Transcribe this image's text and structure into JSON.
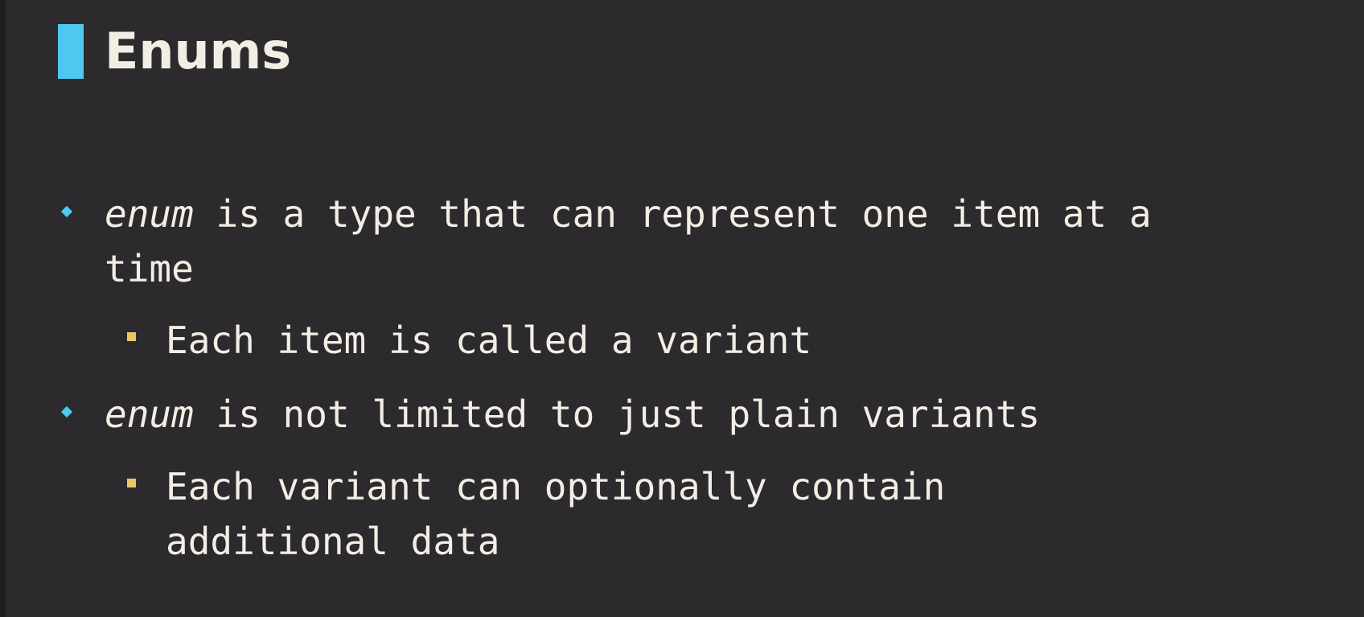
{
  "slide": {
    "title": "Enums",
    "accent_color": "#4ec8ef",
    "sub_bullet_color": "#e8c964",
    "background_color": "#2c2a2d",
    "text_color": "#f1efe4"
  },
  "bullets": [
    {
      "icon": "diamond-bullet-icon",
      "keyword": "enum",
      "rest_line1": " is a type that can represent one item at a",
      "line2": "time",
      "sub_bullets": [
        {
          "icon": "square-bullet-icon",
          "line1": "Each item is called a variant"
        }
      ]
    },
    {
      "icon": "diamond-bullet-icon",
      "keyword": "enum",
      "rest_line1": " is not limited to just plain variants",
      "sub_bullets": [
        {
          "icon": "square-bullet-icon",
          "line1": "Each variant can optionally contain",
          "line2": "additional data"
        }
      ]
    }
  ]
}
